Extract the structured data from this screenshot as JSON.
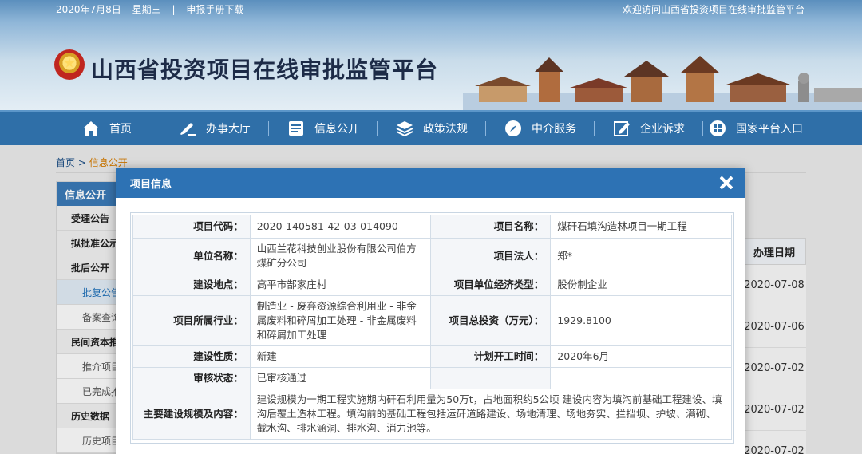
{
  "header": {
    "date": "2020年7月8日",
    "weekday": "星期三",
    "separator": "|",
    "download_link": "申报手册下载",
    "welcome": "欢迎访问山西省投资项目在线审批监管平台",
    "site_title": "山西省投资项目在线审批监管平台"
  },
  "nav": [
    {
      "label": "首页",
      "icon": "home-icon"
    },
    {
      "label": "办事大厅",
      "icon": "edit-icon"
    },
    {
      "label": "信息公开",
      "icon": "info-board-icon"
    },
    {
      "label": "政策法规",
      "icon": "layers-icon"
    },
    {
      "label": "中介服务",
      "icon": "compass-icon"
    },
    {
      "label": "企业诉求",
      "icon": "write-icon"
    },
    {
      "label": "国家平台入口",
      "icon": "grid-icon"
    }
  ],
  "breadcrumb": {
    "home": "首页",
    "sep": ">",
    "current": "信息公开"
  },
  "sidebar": {
    "title": "信息公开",
    "items": [
      {
        "label": "受理公告",
        "kind": "main"
      },
      {
        "label": "拟批准公示",
        "kind": "main"
      },
      {
        "label": "批后公开",
        "kind": "main"
      },
      {
        "label": "批复公告",
        "kind": "sub-active"
      },
      {
        "label": "备案查询",
        "kind": "sub"
      },
      {
        "label": "民间资本推介",
        "kind": "main"
      },
      {
        "label": "推介项目",
        "kind": "sub"
      },
      {
        "label": "已完成推介",
        "kind": "sub"
      },
      {
        "label": "历史数据",
        "kind": "main"
      },
      {
        "label": "历史项目",
        "kind": "sub"
      }
    ]
  },
  "list": {
    "column_header": "办理日期",
    "dates": [
      "2020-07-08",
      "2020-07-06",
      "2020-07-02",
      "2020-07-02",
      "2020-07-02"
    ]
  },
  "modal": {
    "title": "项目信息",
    "rows": [
      {
        "l1": "项目代码：",
        "v1": "2020-140581-42-03-014090",
        "l2": "项目名称：",
        "v2": "煤矸石填沟造林项目一期工程"
      },
      {
        "l1": "单位名称：",
        "v1": "山西兰花科技创业股份有限公司伯方煤矿分公司",
        "l2": "项目法人：",
        "v2": "郑*"
      },
      {
        "l1": "建设地点：",
        "v1": "高平市郜家庄村",
        "l2": "项目单位经济类型：",
        "v2": "股份制企业"
      },
      {
        "l1": "项目所属行业：",
        "v1": "制造业 - 废弃资源综合利用业 - 非金属废料和碎屑加工处理 - 非金属废料和碎屑加工处理",
        "l2": "项目总投资（万元）：",
        "v2": "1929.8100"
      },
      {
        "l1": "建设性质：",
        "v1": "新建",
        "l2": "计划开工时间：",
        "v2": "2020年6月"
      },
      {
        "l1": "审核状态：",
        "v1": "已审核通过",
        "l2": "",
        "v2": ""
      }
    ],
    "scope_label": "主要建设规模及内容：",
    "scope_value": "建设规模为一期工程实施期内矸石利用量为50万t，占地面积约5公顷 建设内容为填沟前基础工程建设、填沟后覆土造林工程。填沟前的基础工程包括运矸道路建设、场地清理、场地夯实、拦挡坝、护坡、满砌、截水沟、排水涵洞、排水沟、消力池等。"
  },
  "colors": {
    "nav_bg": "#2f6fa8",
    "modal_head": "#2d72b4",
    "crumb_current": "#d47b00"
  }
}
